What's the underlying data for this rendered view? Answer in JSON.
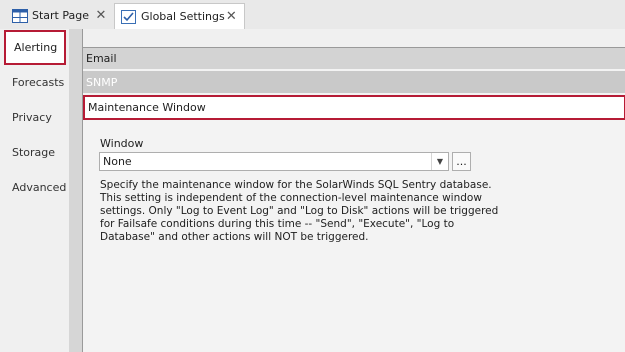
{
  "tabs": [
    {
      "label": "Start Page",
      "icon": "grid-icon"
    },
    {
      "label": "Global Settings",
      "icon": "checklist-icon"
    }
  ],
  "tab_close_glyph": "✕",
  "left_nav": {
    "items": [
      {
        "label": "Alerting"
      },
      {
        "label": "Forecasts"
      },
      {
        "label": "Privacy"
      },
      {
        "label": "Storage"
      },
      {
        "label": "Advanced"
      }
    ],
    "active": "Alerting"
  },
  "sections": {
    "email": "Email",
    "snmp": "SNMP",
    "maintenance": "Maintenance Window"
  },
  "window": {
    "label": "Window",
    "value": "None",
    "ellipsis": "..."
  },
  "description_lines": [
    "Specify the maintenance window for the SolarWinds SQL Sentry database.",
    "This setting is independent of the connection-level maintenance window",
    "settings. Only \"Log to Event Log\" and \"Log to Disk\" actions will be triggered",
    "for Failsafe conditions during this time -- \"Send\", \"Execute\", \"Log to",
    "Database\" and other actions will NOT be triggered."
  ],
  "colors": {
    "highlight_border": "#b61b35"
  }
}
